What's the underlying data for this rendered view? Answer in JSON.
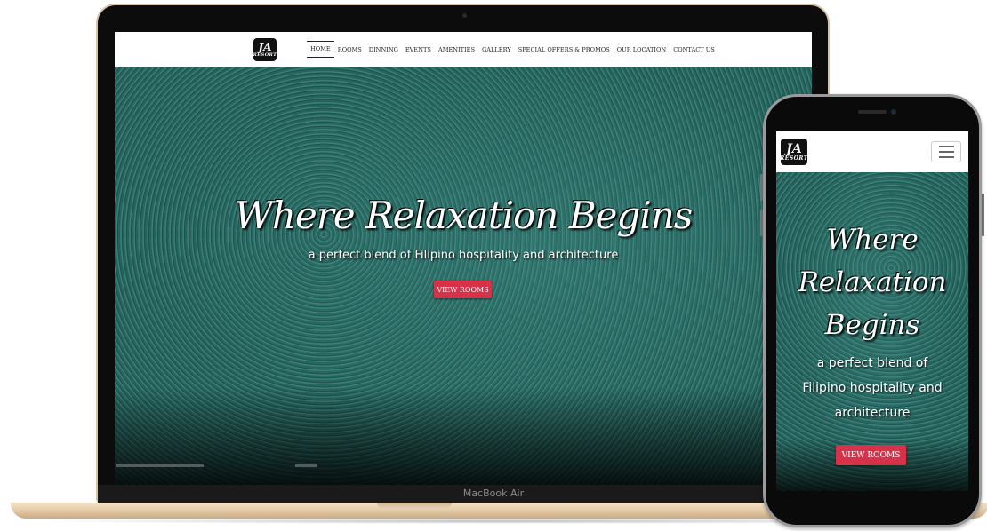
{
  "laptop": {
    "device_label": "MacBook Air",
    "logo": {
      "mark": "JA",
      "word": "RESORT"
    },
    "nav_items": [
      {
        "label": "HOME",
        "active": true
      },
      {
        "label": "ROOMS",
        "active": false
      },
      {
        "label": "DINNING",
        "active": false
      },
      {
        "label": "EVENTS",
        "active": false
      },
      {
        "label": "AMENITIES",
        "active": false
      },
      {
        "label": "GALLERY",
        "active": false
      },
      {
        "label": "SPECIAL OFFERS & PROMOS",
        "active": false
      },
      {
        "label": "OUR LOCATION",
        "active": false
      },
      {
        "label": "CONTACT US",
        "active": false
      }
    ],
    "hero": {
      "title": "Where Relaxation Begins",
      "subtitle": "a perfect blend of Filipino hospitality and architecture",
      "button_label": "VIEW ROOMS"
    }
  },
  "phone": {
    "logo": {
      "mark": "JA",
      "word": "RESORT"
    },
    "menu_icon": "hamburger-icon",
    "hero": {
      "title_lines": [
        "Where",
        "Relaxation",
        "Begins"
      ],
      "subtitle_lines": [
        "a perfect blend of",
        "Filipino hospitality and",
        "architecture"
      ],
      "button_label": "VIEW ROOMS"
    }
  },
  "colors": {
    "accent_button": "#d6334b",
    "hero_teal": "#1f5a54",
    "laptop_body": "#e8cfae"
  }
}
